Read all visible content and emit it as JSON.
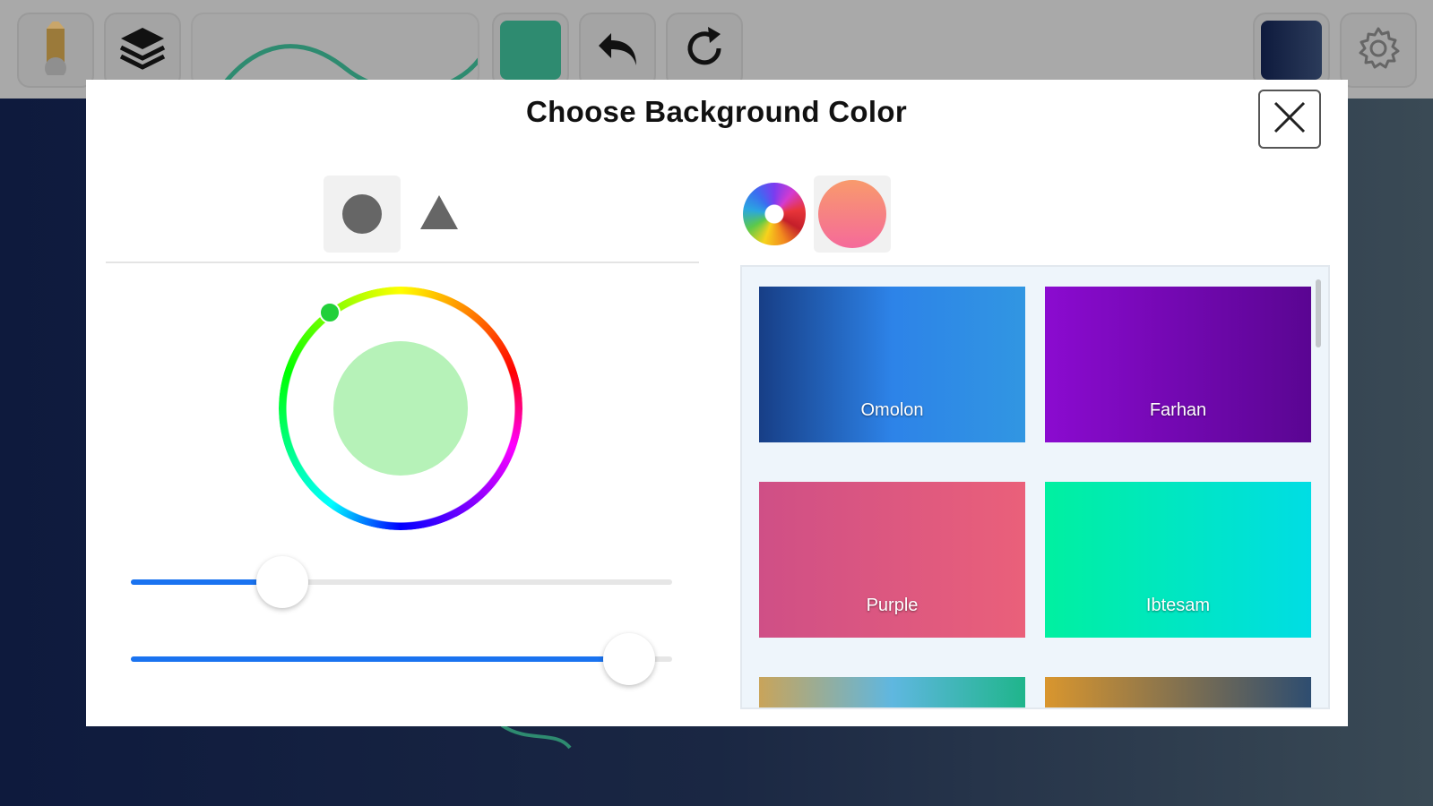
{
  "toolbar": {
    "buttons": [
      {
        "icon": "pencil-icon"
      },
      {
        "icon": "layers-icon"
      },
      {
        "icon": "color-swatch-icon",
        "color": "#2e8b70"
      },
      {
        "icon": "undo-icon"
      },
      {
        "icon": "redo-icon"
      },
      {
        "icon": "background-swatch-icon",
        "color": "#1b2a47"
      },
      {
        "icon": "gear-icon"
      }
    ]
  },
  "modal": {
    "title": "Choose Background Color",
    "close_icon": "close-icon",
    "shape_tabs": [
      {
        "icon": "circle-icon",
        "selected": true
      },
      {
        "icon": "triangle-icon",
        "selected": false
      }
    ],
    "color_picker": {
      "selected_color": "#b6f2b8",
      "handle_color": "#22d03a",
      "slider_1_value_percent": 28,
      "slider_2_value_percent": 92
    },
    "mode_tabs": [
      {
        "icon": "color-wheel-icon",
        "selected": false
      },
      {
        "icon": "gradient-icon",
        "selected": true
      }
    ],
    "gradients": [
      {
        "name": "Omolon",
        "colors": [
          "#173e86",
          "#2d83e8",
          "#3196e2"
        ]
      },
      {
        "name": "Farhan",
        "colors": [
          "#8b0bd0",
          "#5a0592"
        ]
      },
      {
        "name": "Purple",
        "colors": [
          "#cf4f86",
          "#ea607a"
        ]
      },
      {
        "name": "Ibtesam",
        "colors": [
          "#00f0a0",
          "#00dde4"
        ]
      },
      {
        "name": "",
        "colors": [
          "#c9a45a",
          "#5fb7e0",
          "#1fb58b"
        ]
      },
      {
        "name": "",
        "colors": [
          "#d9962e",
          "#2e4d70"
        ]
      }
    ]
  }
}
